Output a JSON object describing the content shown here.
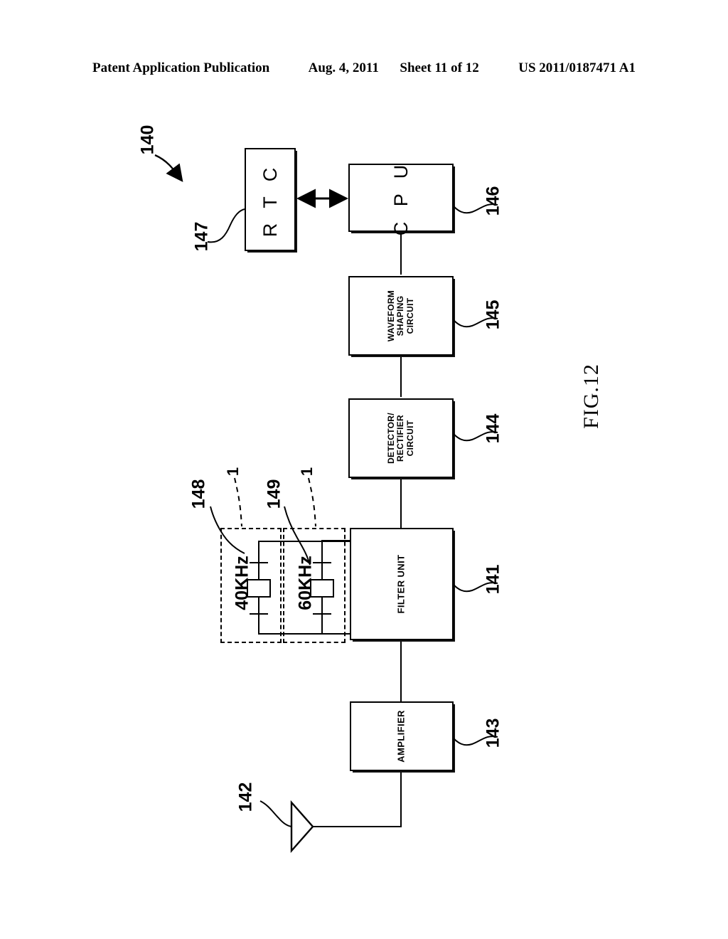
{
  "header": {
    "publication": "Patent Application Publication",
    "date": "Aug. 4, 2011",
    "sheet": "Sheet 11 of 12",
    "patent_number": "US 2011/0187471 A1"
  },
  "figure": {
    "caption": "FIG.12",
    "assembly_ref": "140"
  },
  "blocks": {
    "rtc": {
      "label": "R T C",
      "ref": "147"
    },
    "cpu": {
      "label": "C P U",
      "ref": "146"
    },
    "waveform": {
      "label": "WAVEFORM\nSHAPING\nCIRCUIT",
      "ref": "145"
    },
    "detector": {
      "label": "DETECTOR/\nRECTIFIER\nCIRCUIT",
      "ref": "144"
    },
    "filter": {
      "label": "FILTER UNIT",
      "ref": "141"
    },
    "amplifier": {
      "label": "AMPLIFIER",
      "ref": "143"
    },
    "antenna": {
      "label": "",
      "ref": "142"
    }
  },
  "filters": [
    {
      "ref": "148",
      "frequency": "40KHz",
      "tick": "1"
    },
    {
      "ref": "149",
      "frequency": "60KHz",
      "tick": "1"
    }
  ],
  "colors": {
    "line": "#000000",
    "background": "#ffffff"
  }
}
